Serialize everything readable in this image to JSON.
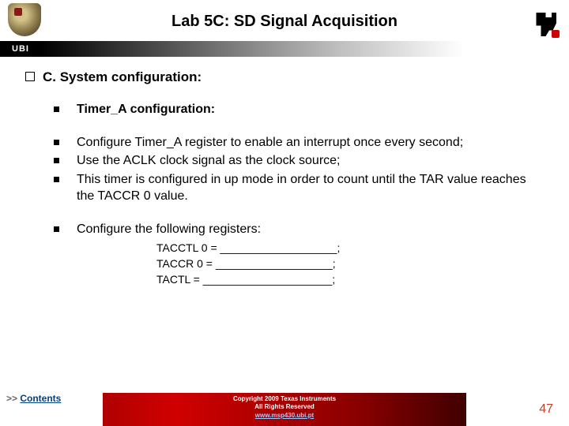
{
  "header": {
    "title": "Lab 5C: SD Signal Acquisition",
    "ubi_label": "UBI"
  },
  "section": {
    "title": "C. System configuration:"
  },
  "bullets": {
    "b1": "Timer_A configuration:",
    "b2": "Configure Timer_A register to enable an interrupt once every second;",
    "b3": "Use the ACLK clock signal as the clock source;",
    "b4": "This timer is configured in up mode in order to count until the TAR value reaches the TACCR 0 value.",
    "b5": "Configure the following registers:"
  },
  "registers": {
    "r1": "TACCTL 0 = ___________________;",
    "r2": "TACCR 0 = ___________________;",
    "r3": "TACTL = _____________________;"
  },
  "footer": {
    "arrows": ">>",
    "contents": "Contents",
    "copyright": "Copyright 2009 Texas Instruments",
    "rights": "All Rights Reserved",
    "url": "www.msp430.ubi.pt",
    "slide_num": "47"
  }
}
